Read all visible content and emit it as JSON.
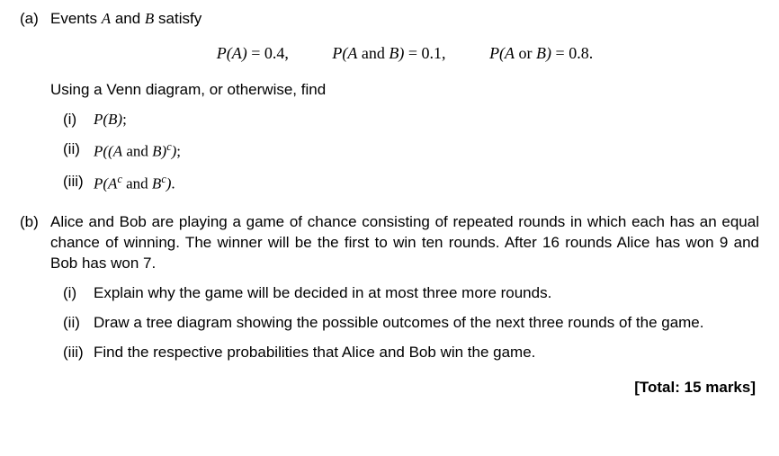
{
  "a": {
    "label": "(a)",
    "intro_pre": "Events ",
    "intro_A": "A",
    "intro_mid": " and ",
    "intro_B": "B",
    "intro_post": " satisfy",
    "eq1_lhs": "P(A)",
    "eq1_eq": " = 0.4,",
    "eq2_pre": "P(A",
    "eq2_and": " and ",
    "eq2_post": "B)",
    "eq2_eq": " = 0.1,",
    "eq3_pre": "P(A",
    "eq3_or": " or ",
    "eq3_post": "B)",
    "eq3_eq": " = 0.8.",
    "hint": "Using a Venn diagram, or otherwise, find",
    "i": {
      "num": "(i)",
      "pre": "P(B)",
      "tail": ";"
    },
    "ii": {
      "num": "(ii)",
      "pre": "P((A",
      "and": " and ",
      "mid": "B)",
      "sup": "c",
      "close": ")",
      "tail": ";"
    },
    "iii": {
      "num": "(iii)",
      "pre": "P(A",
      "sup1": "c",
      "and": " and ",
      "mid": "B",
      "sup2": "c",
      "close": ")",
      "tail": "."
    }
  },
  "b": {
    "label": "(b)",
    "para": "Alice and Bob are playing a game of chance consisting of repeated rounds in which each has an equal chance of winning. The winner will be the first to win ten rounds. After 16 rounds Alice has won 9 and Bob has won 7.",
    "i": {
      "num": "(i)",
      "txt": "Explain why the game will be decided in at most three more rounds."
    },
    "ii": {
      "num": "(ii)",
      "txt": "Draw a tree diagram showing the possible outcomes of the next three rounds of the game."
    },
    "iii": {
      "num": "(iii)",
      "txt": "Find the respective probabilities that Alice and Bob win the game."
    }
  },
  "total": "[Total: 15 marks]"
}
